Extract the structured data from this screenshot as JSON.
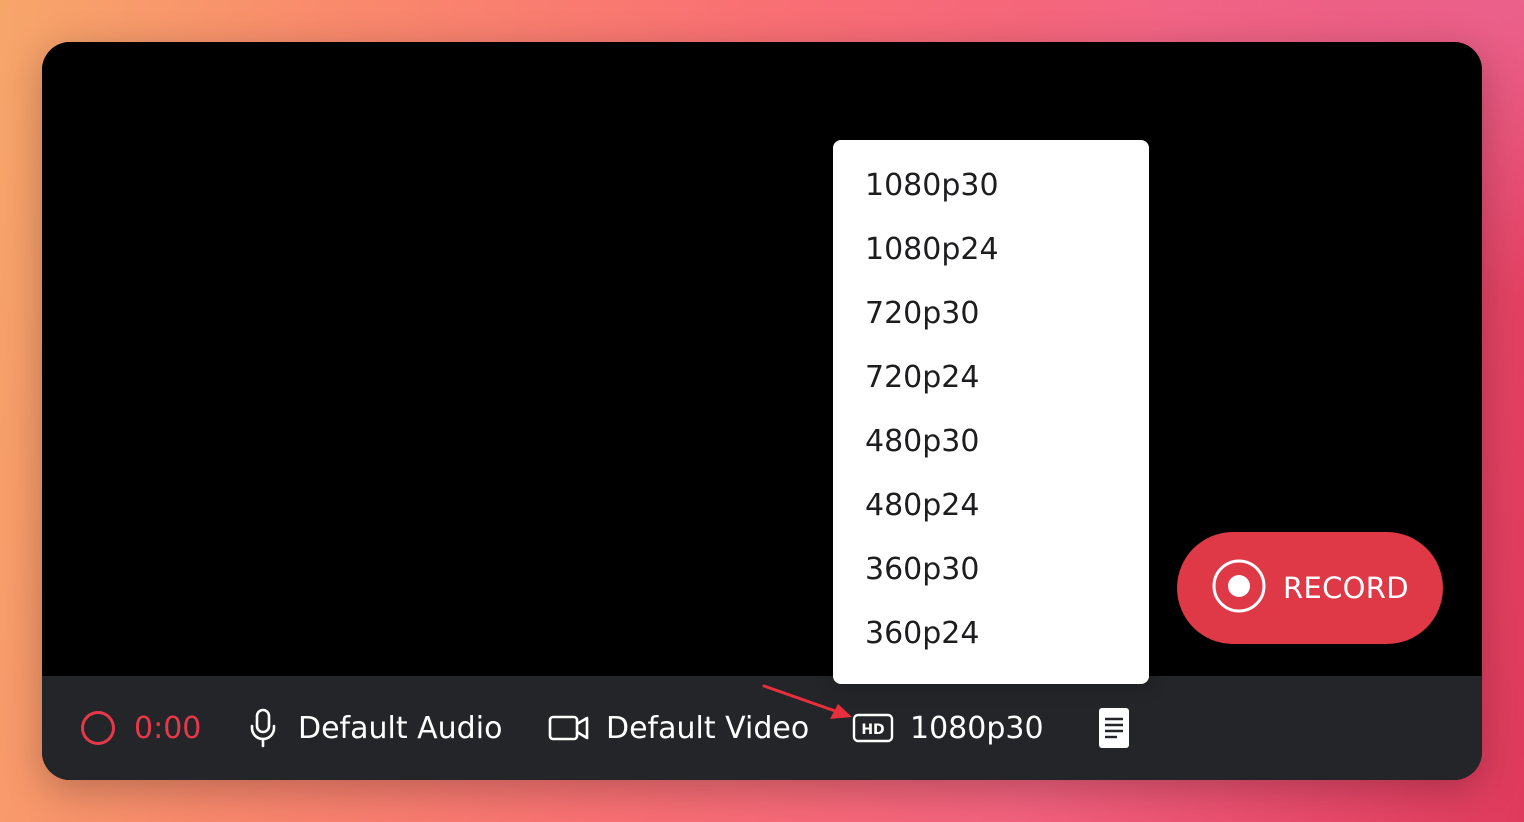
{
  "toolbar": {
    "timer": "0:00",
    "audio_label": "Default Audio",
    "video_label": "Default Video",
    "quality_label": "1080p30",
    "quality_badge": "HD"
  },
  "dropdown": {
    "options": [
      "1080p30",
      "1080p24",
      "720p30",
      "720p24",
      "480p30",
      "480p24",
      "360p30",
      "360p24"
    ]
  },
  "record_button": {
    "label": "RECORD"
  },
  "icons": {
    "record_status": "record-circle-icon",
    "audio": "microphone-icon",
    "video": "video-camera-icon",
    "quality": "hd-icon",
    "notes": "document-icon",
    "record": "record-dot-icon",
    "annotation": "red-arrow-icon"
  },
  "colors": {
    "accent_red": "#df3947",
    "timer_red": "#e5394a",
    "toolbar_bg": "#232529",
    "preview_bg": "#000000",
    "annotation_arrow": "#e8303c"
  }
}
